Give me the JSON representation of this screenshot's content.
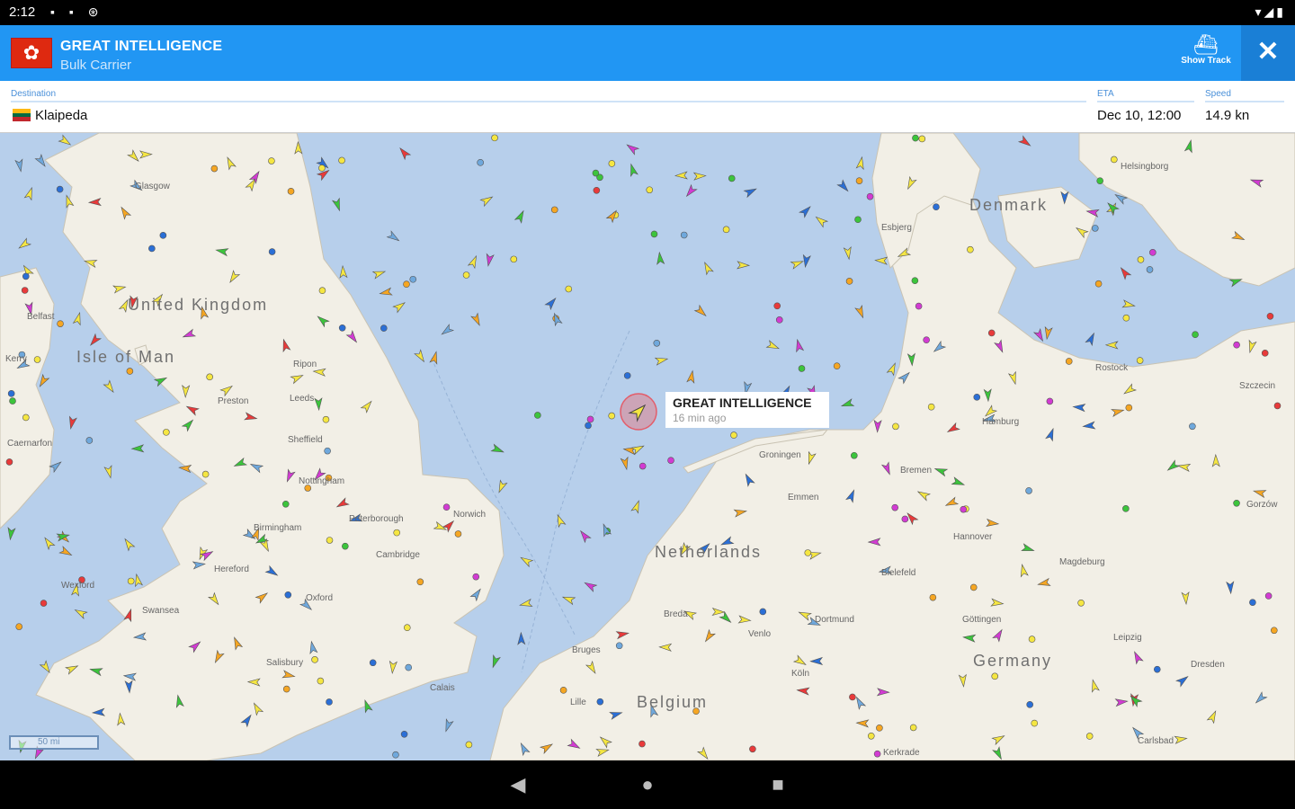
{
  "status_bar": {
    "time": "2:12",
    "left_icons": "▪ ▪ ⊛",
    "right_icons": "▾◢▮"
  },
  "header": {
    "vessel_name": "GREAT INTELLIGENCE",
    "vessel_type": "Bulk Carrier",
    "flag_icon": "hong-kong-flag-icon",
    "flag_glyph": "✿",
    "show_track_label": "Show Track",
    "show_track_glyph": "⛴",
    "close_glyph": "✕"
  },
  "info": {
    "destination_label": "Destination",
    "destination_value": "Klaipeda",
    "destination_flag_colors": [
      "#fdb913",
      "#006a44",
      "#c1272d"
    ],
    "eta_label": "ETA",
    "eta_value": "Dec 10, 12:00",
    "speed_label": "Speed",
    "speed_value": "14.9 kn"
  },
  "map": {
    "countries": [
      "United Kingdom",
      "Isle of Man",
      "Netherlands",
      "Germany",
      "Belgium",
      "Denmark"
    ],
    "cities": [
      "Glasgow",
      "Belfast",
      "Kerry",
      "Ripon",
      "Leeds",
      "Preston",
      "Sheffield",
      "Nottingham",
      "Peterborough",
      "Birmingham",
      "Cambridge",
      "Hereford",
      "Oxford",
      "Swansea",
      "Salisbury",
      "Norwich",
      "Groningen",
      "Emmen",
      "Bremen",
      "Hamburg",
      "Hannover",
      "Bielefeld",
      "Magdeburg",
      "Dortmund",
      "Göttingen",
      "Leipzig",
      "Dresden",
      "Breda",
      "Venlo",
      "Köln",
      "Bruges",
      "Lille",
      "Carlsbad",
      "Rostock",
      "Helsingborg",
      "Esbjerg",
      "Szczecin",
      "Gorzów",
      "Kerkrade",
      "Calais",
      "Wexford",
      "Caernarfon"
    ],
    "selected_vessel": {
      "name": "GREAT INTELLIGENCE",
      "age": "16 min ago"
    },
    "scale_label": "50 mi",
    "water_color": "#b7cfeb",
    "land_color": "#f2efe6"
  },
  "nav": {
    "back": "◀",
    "home": "●",
    "recents": "■"
  }
}
